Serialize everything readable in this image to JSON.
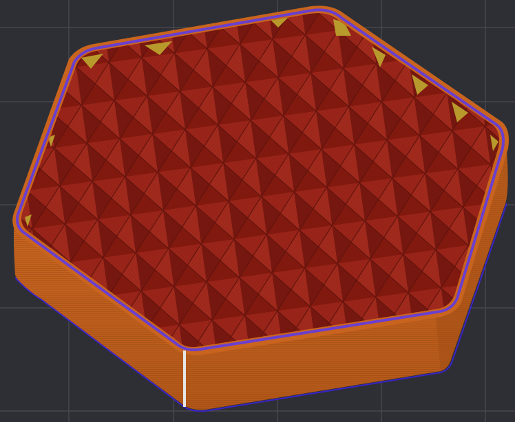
{
  "viewport": {
    "label": "",
    "colors": {
      "background": "#2e2f34",
      "grid_line": "#46474d",
      "outer_wall": "#c9641e",
      "outer_wall_shade": "#a24e15",
      "inner_wall": "#6a3fd0",
      "infill": "#8e1f16",
      "infill_line": "#6b150e",
      "solid_infill": "#b89a2c",
      "seam": "#e6e6e6",
      "base_edge": "#3a24c8"
    }
  }
}
